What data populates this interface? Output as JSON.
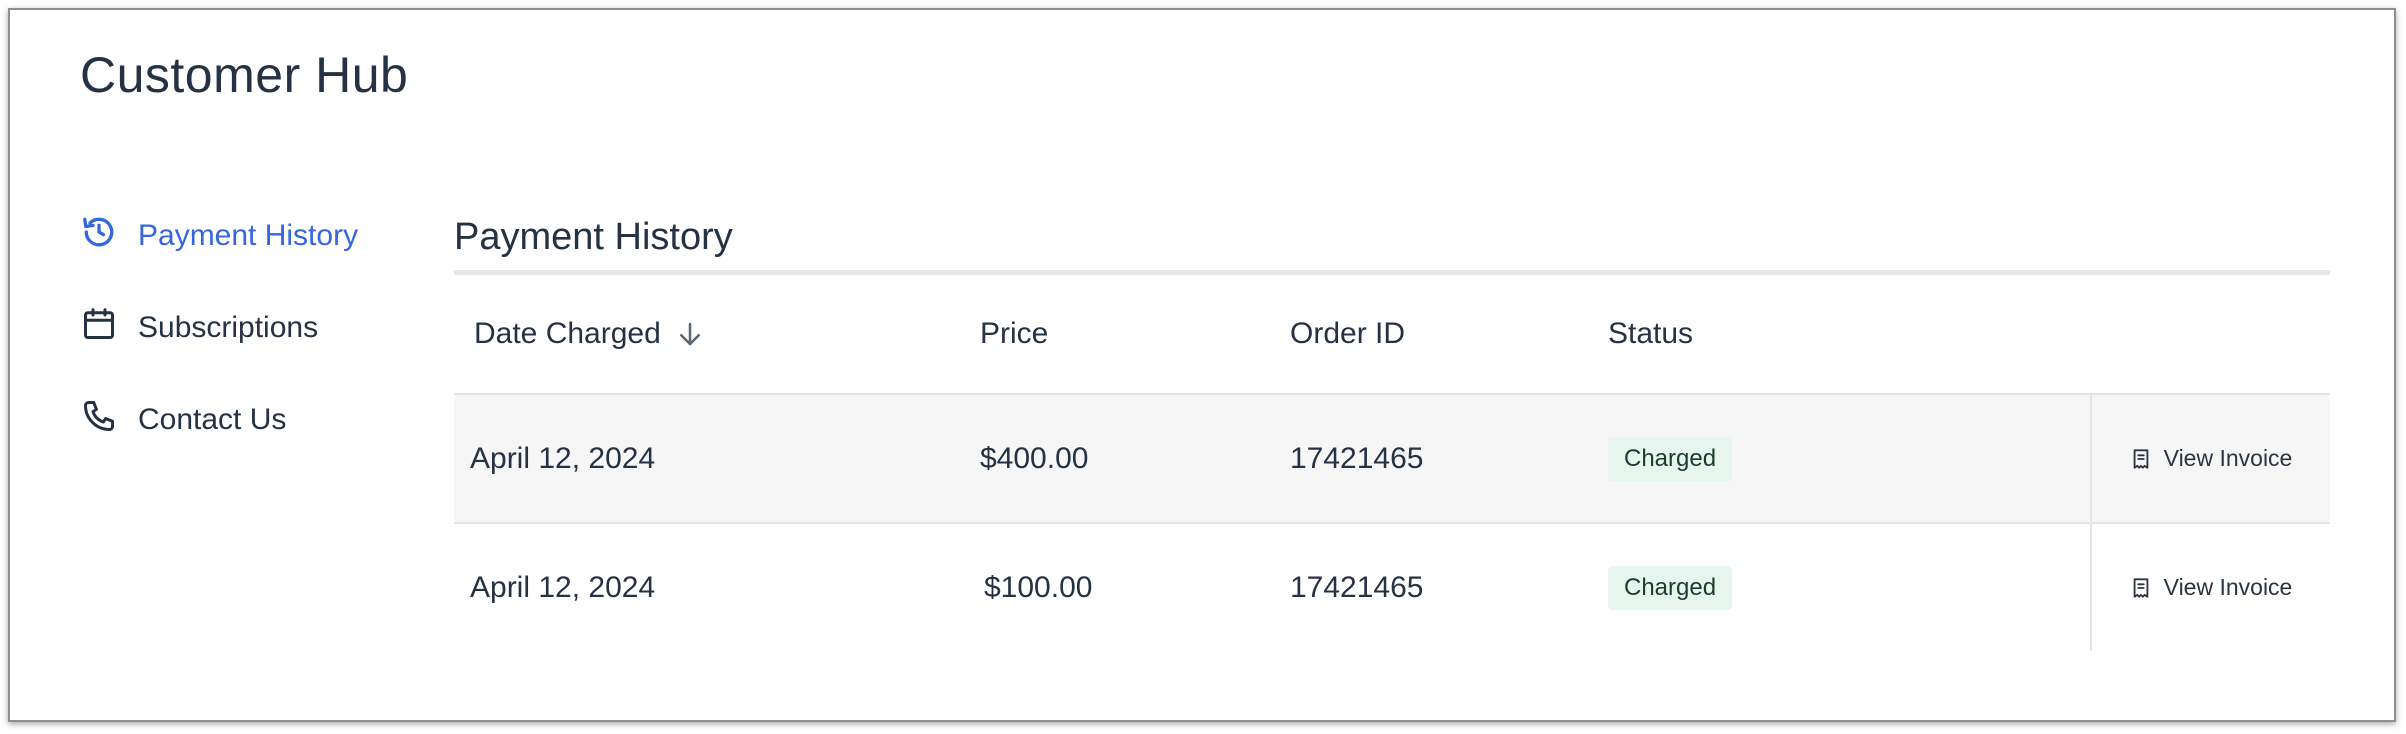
{
  "app": {
    "title": "Customer Hub",
    "accent_color": "#3466e0",
    "text_color": "#253243"
  },
  "sidebar": {
    "items": [
      {
        "label": "Payment History",
        "icon": "history-icon",
        "active": true
      },
      {
        "label": "Subscriptions",
        "icon": "calendar-icon",
        "active": false
      },
      {
        "label": "Contact Us",
        "icon": "phone-icon",
        "active": false
      }
    ]
  },
  "main": {
    "title": "Payment History",
    "table": {
      "headers": {
        "date": "Date Charged",
        "price": "Price",
        "order_id": "Order ID",
        "status": "Status"
      },
      "sort": {
        "column": "date",
        "direction": "descending",
        "icon": "arrow-down-icon"
      },
      "rows": [
        {
          "date": "April 12, 2024",
          "price": "$400.00",
          "order_id": "17421465",
          "status": "Charged",
          "action": "View Invoice"
        },
        {
          "date": "April 12, 2024",
          "price": "$100.00",
          "order_id": "17421465",
          "status": "Charged",
          "action": "View Invoice"
        }
      ],
      "status_badge_color": "#e6f6ee"
    }
  }
}
